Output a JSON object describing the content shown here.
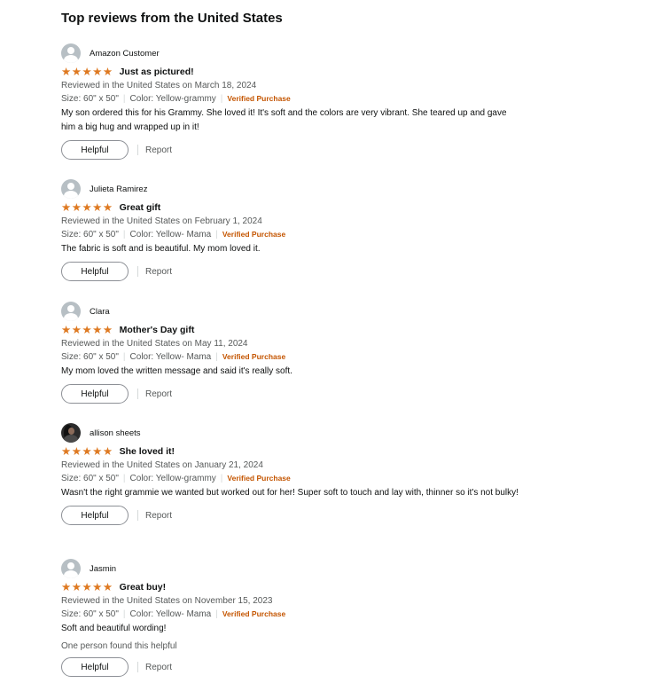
{
  "section": {
    "title": "Top reviews from the United States"
  },
  "reviews": [
    {
      "name": "Amazon Customer",
      "avatar": "default-avatar-icon",
      "stars": 5,
      "title": "Just as pictured!",
      "meta": "Reviewed in the United States on March 18, 2024",
      "size": "Size: 60\" x 50\"",
      "color": "Color: Yellow-grammy",
      "verified": "Verified Purchase",
      "body": "My son ordered this for his Grammy. She loved it! It's soft and the colors are very vibrant. She teared up and gave him a big hug and wrapped up in it!",
      "helpful_count": "",
      "helpful": "Helpful",
      "report": "Report"
    },
    {
      "name": "Julieta Ramirez",
      "avatar": "default-avatar-icon",
      "stars": 5,
      "title": "Great gift",
      "meta": "Reviewed in the United States on February 1, 2024",
      "size": "Size: 60\" x 50\"",
      "color": "Color: Yellow- Mama",
      "verified": "Verified Purchase",
      "body": "The fabric is soft and is beautiful. My mom loved it.",
      "helpful_count": "",
      "helpful": "Helpful",
      "report": "Report"
    },
    {
      "name": "Clara",
      "avatar": "default-avatar-icon",
      "stars": 5,
      "title": "Mother's Day gift",
      "meta": "Reviewed in the United States on May 11, 2024",
      "size": "Size: 60\" x 50\"",
      "color": "Color: Yellow- Mama",
      "verified": "Verified Purchase",
      "body": "My mom loved the written message and said it's really soft.",
      "helpful_count": "",
      "helpful": "Helpful",
      "report": "Report"
    },
    {
      "name": "allison sheets",
      "avatar": "profile-photo",
      "stars": 5,
      "title": "She loved it!",
      "meta": "Reviewed in the United States on January 21, 2024",
      "size": "Size: 60\" x 50\"",
      "color": "Color: Yellow-grammy",
      "verified": "Verified Purchase",
      "body": "Wasn't the right grammie we wanted but worked out for her! Super soft to touch and lay with, thinner so it's not bulky!",
      "helpful_count": "",
      "helpful": "Helpful",
      "report": "Report"
    },
    {
      "name": "Jasmin",
      "avatar": "default-avatar-icon",
      "stars": 5,
      "title": "Great buy!",
      "meta": "Reviewed in the United States on November 15, 2023",
      "size": "Size: 60\" x 50\"",
      "color": "Color: Yellow- Mama",
      "verified": "Verified Purchase",
      "body": "Soft and beautiful wording!",
      "helpful_count": "One person found this helpful",
      "helpful": "Helpful",
      "report": "Report"
    }
  ],
  "colors": {
    "star": "#de7921",
    "verified": "#c45500",
    "meta": "#565959"
  }
}
